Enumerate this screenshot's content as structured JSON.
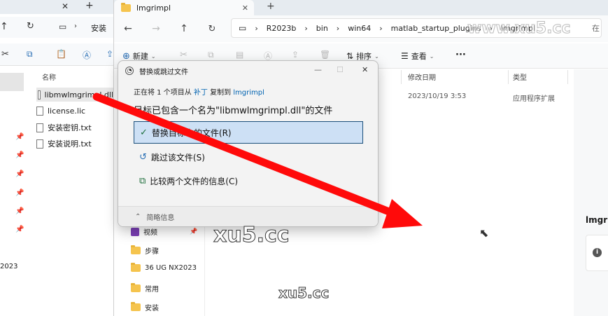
{
  "back_window": {
    "address_fragment": "安装",
    "column_name": "名称",
    "files": [
      "libmwlmgrimpl.dll",
      "license.lic",
      "安装密钥.txt",
      "安装说明.txt"
    ],
    "side_text": "2023"
  },
  "front_window": {
    "tab_title": "lmgrimpl",
    "breadcrumb": [
      "R2023b",
      "bin",
      "win64",
      "matlab_startup_plugins",
      "lmgrimpl"
    ],
    "address_search_fragment": "在",
    "toolbar": {
      "new_label": "新建",
      "sort_label": "排序",
      "view_label": "查看",
      "more_label": "···"
    },
    "columns": {
      "modified": "修改日期",
      "type": "类型"
    },
    "row": {
      "modified": "2023/10/19 3:53",
      "type": "应用程序扩展"
    },
    "nav_items": [
      "视频",
      "步骤",
      "36 UG NX2023",
      "常用",
      "安装"
    ],
    "details_title": "lmgri"
  },
  "dialog": {
    "title": "替换或跳过文件",
    "line1_prefix": "正在将 1 个项目从 ",
    "line1_source": "补丁",
    "line1_middle": " 复制到 ",
    "line1_dest": "lmgrimpl",
    "line2": "目标已包含一个名为\"libmwlmgrimpl.dll\"的文件",
    "options": {
      "replace": "替换目标中的文件(R)",
      "skip": "跳过该文件(S)",
      "compare": "比较两个文件的信息(C)"
    },
    "footer": "简略信息"
  },
  "watermarks": {
    "top": "www.xu5.cc",
    "middle": "xu5.cc",
    "bottom": "xu5.cc"
  },
  "colors": {
    "accent": "#0063b1",
    "selection": "#cde0f5",
    "arrow": "#ff0a0a",
    "folder": "#f5c44e"
  }
}
